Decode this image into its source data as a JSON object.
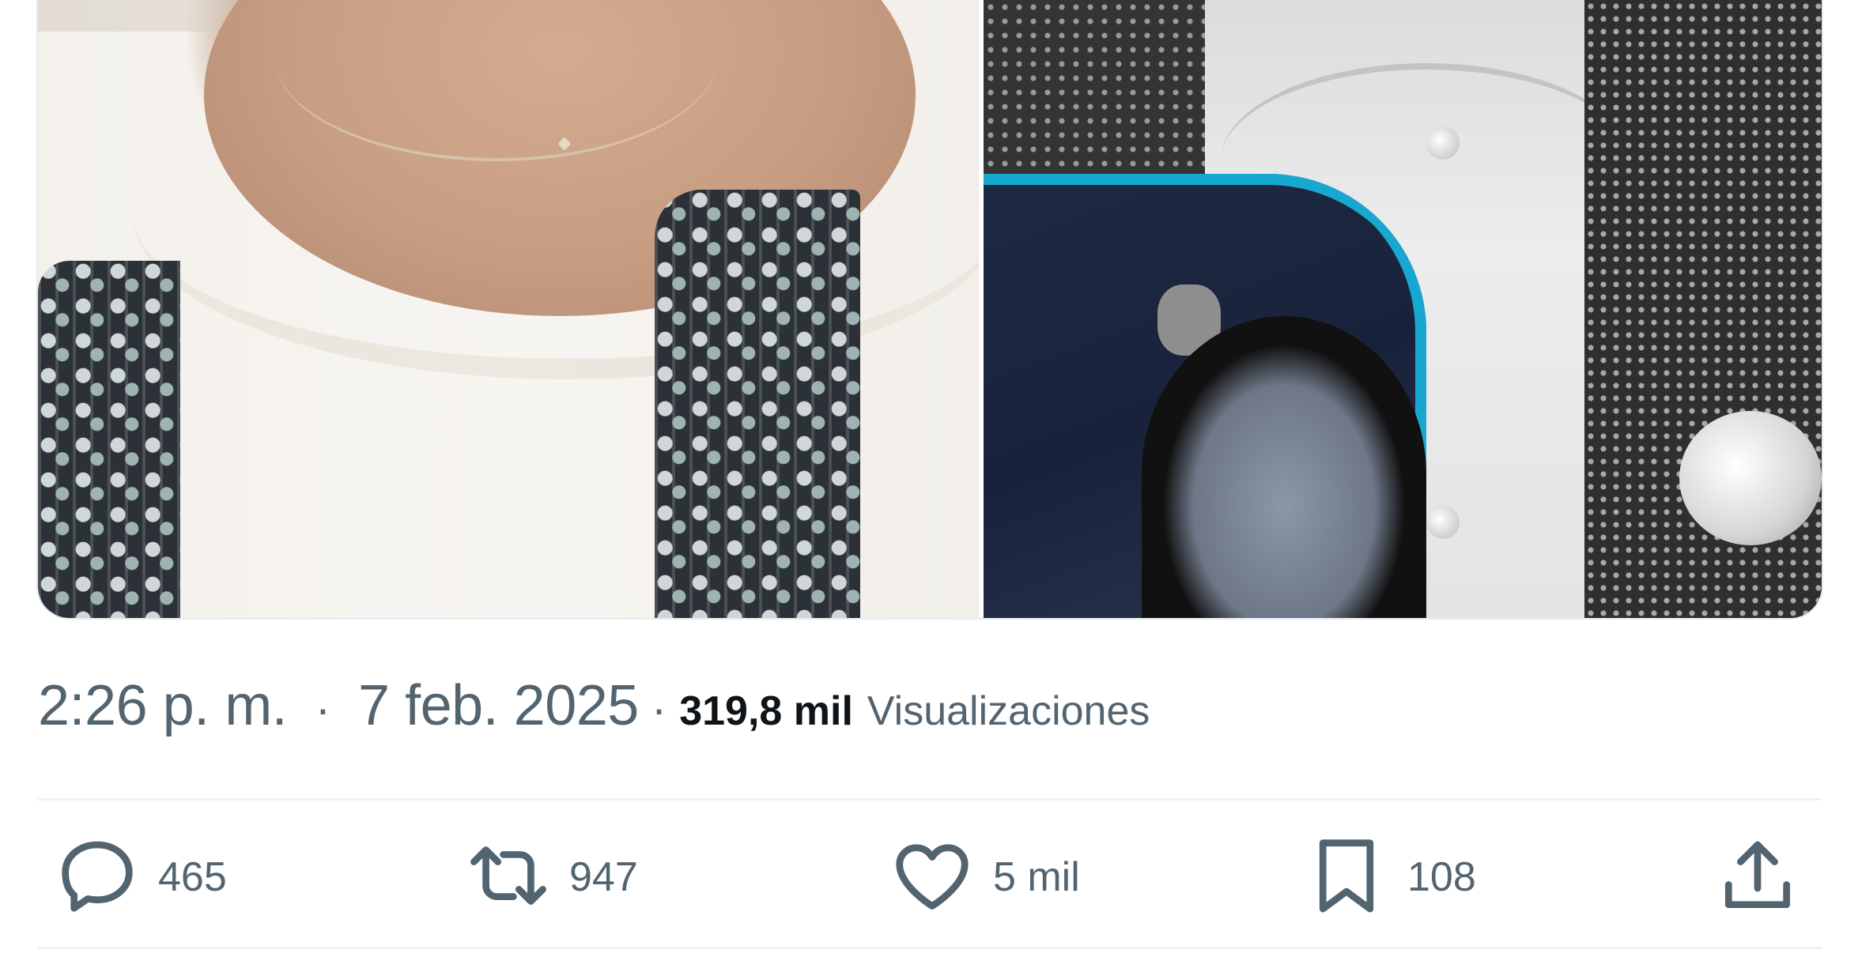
{
  "tweet": {
    "time": "2:26 p. m.",
    "date": "7 feb. 2025",
    "separator": "·",
    "views_count": "319,8 mil",
    "views_label": "Visualizaciones"
  },
  "actions": {
    "replies": "465",
    "reposts": "947",
    "likes": "5 mil",
    "bookmarks": "108"
  },
  "colors": {
    "text_secondary": "#536471",
    "text_primary": "#0f1419",
    "divider": "#eff3f4",
    "cutout_outline": "#17a7d0"
  },
  "icons": [
    "reply-icon",
    "repost-icon",
    "like-icon",
    "bookmark-icon",
    "share-icon"
  ]
}
